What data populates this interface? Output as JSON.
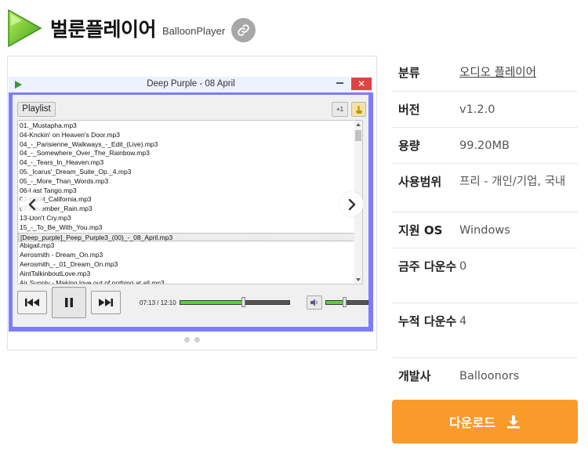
{
  "header": {
    "title": "벌룬플레이어",
    "subtitle": "BalloonPlayer",
    "logo_icon": "green-play-triangle-icon",
    "share_icon": "link-icon"
  },
  "player": {
    "window_title": "Deep Purple - 08 April",
    "close_glyph": "✕",
    "playlist_button": "Playlist",
    "add_button": "+1",
    "time": "07:13 / 12:10",
    "seek_progress": 0.58,
    "volume_level": 0.45,
    "playlist": [
      "01._Mustapha.mp3",
      "04-Knckin' on Heaven's Door.mp3",
      "04_-_Parisienne_Walkways_-_Edit_(Live).mp3",
      "04_-_Somewhere_Over_The_Rainbow.mp3",
      "04_-_Tears_In_Heaven.mp3",
      "05._Icarus'_Dream_Suite_Op._4.mp3",
      "05_-_More_Than_Words.mp3",
      "06-Last Tango.mp3",
      "07-Hotel_California.mp3",
      "07-November_Rain.mp3",
      "13-Don't Cry.mp3",
      "15_-_To_Be_With_You.mp3",
      "[Deep_purple]_Peep_Purple3_(00)_-_08_April.mp3",
      "Abigail.mp3",
      "Aerosmith - Dream_On.mp3",
      "Aerosmith_-_01_Dream_On.mp3",
      "AintTalkinboutLove.mp3",
      "Air Supply - Making love out of nothing at all.mp3"
    ],
    "active_index": 12
  },
  "info": [
    {
      "label": "분류",
      "value": "오디오 플레이어",
      "link": true
    },
    {
      "label": "버전",
      "value": "v1.2.0"
    },
    {
      "label": "용량",
      "value": "99.20MB"
    },
    {
      "label": "사용범위",
      "value": "프리 - 개인/기업, 국내"
    },
    {
      "label": "지원 OS",
      "value": "Windows"
    },
    {
      "label": "금주 다운수",
      "value": "0"
    },
    {
      "label": "누적 다운수",
      "value": "4"
    },
    {
      "label": "개발사",
      "value": "Balloonors"
    }
  ],
  "download": {
    "label": "다운로드",
    "icon": "download-icon"
  },
  "colors": {
    "accent": "#f99a2b",
    "player_frame": "#7c7cff",
    "progress": "#5bd03a"
  }
}
